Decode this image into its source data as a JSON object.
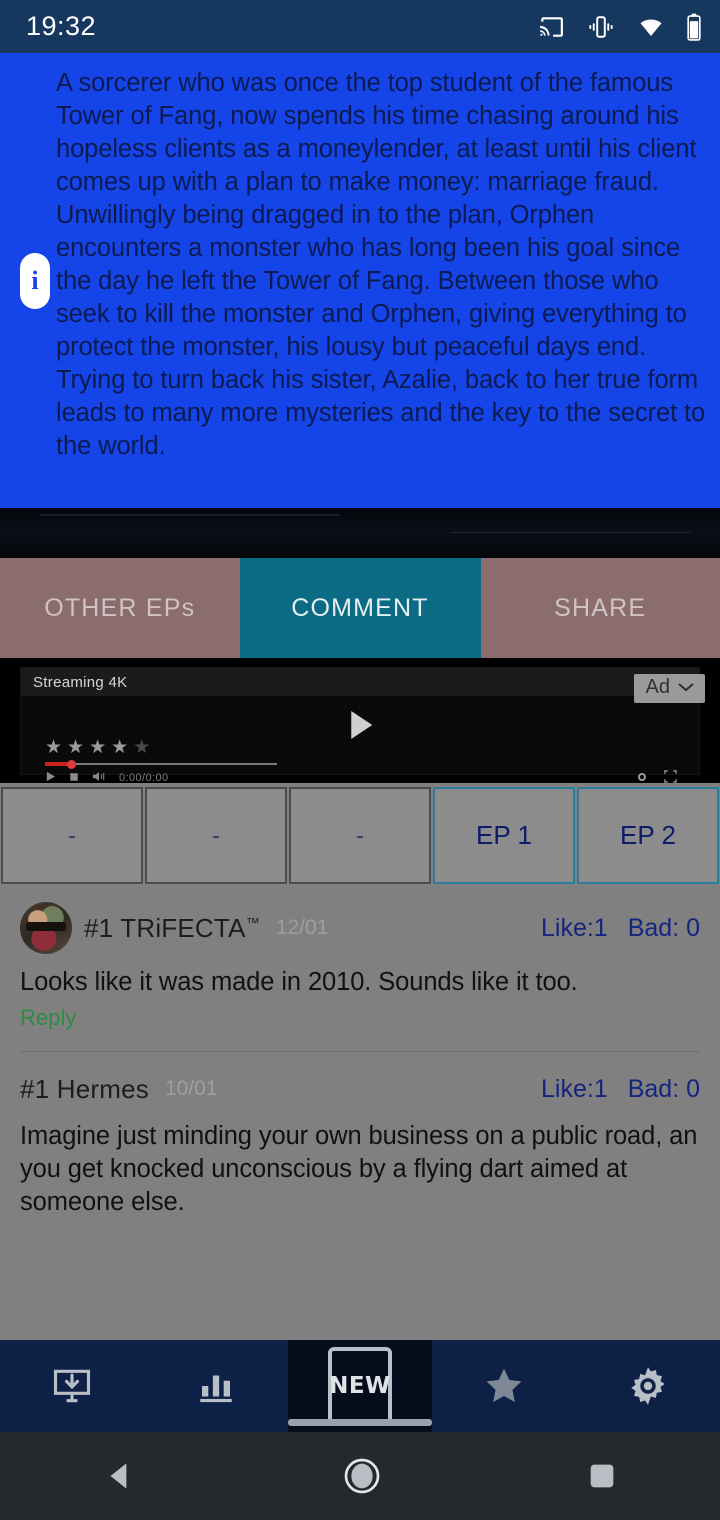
{
  "status_bar": {
    "time": "19:32",
    "icons": [
      "cast-icon",
      "vibrate-icon",
      "wifi-icon",
      "battery-icon"
    ]
  },
  "synopsis": {
    "info_icon_label": "i",
    "text": "A sorcerer who was once the top student of the famous Tower of Fang, now spends his time chasing around his hopeless clients as a moneylender, at least until his client comes up with a plan to make money: marriage fraud. Unwillingly being dragged in to the plan, Orphen encounters a monster who has long been his goal since the day he left the Tower of Fang. Between those who seek to kill the monster and Orphen, giving everything to protect the monster, his lousy but peaceful days end. Trying to turn back his sister, Azalie, back to her true form leads to many more mysteries and the key to the secret to the world."
  },
  "tabs": {
    "other_eps": "OTHER EPs",
    "comment": "COMMENT",
    "share": "SHARE",
    "active": "COMMENT",
    "active_color": "#0b6b84",
    "inactive_color": "#8a6d6c"
  },
  "ad": {
    "title": "Streaming 4K",
    "badge_label": "Ad",
    "badge_chevron": "chevron-down-icon",
    "play_icon": "play-icon",
    "stars_filled": 4,
    "stars_total": 5,
    "time": "0:00/0:00",
    "controls": [
      "play-icon",
      "stop-icon",
      "volume-icon",
      "settings-icon",
      "fullscreen-icon"
    ]
  },
  "episodes": [
    {
      "label": "-",
      "selected": false
    },
    {
      "label": "-",
      "selected": false
    },
    {
      "label": "-",
      "selected": false
    },
    {
      "label": "EP 1",
      "selected": true
    },
    {
      "label": "EP 2",
      "selected": true
    }
  ],
  "comments": [
    {
      "name": "#1 TRiFECTA",
      "name_suffix": "TM",
      "date": "12/01",
      "like": "Like:1",
      "bad": "Bad: 0",
      "body": "Looks like it was made in 2010. Sounds like it too.",
      "reply": "Reply",
      "has_avatar": true
    },
    {
      "name": "#1 Hermes",
      "name_suffix": "",
      "date": "10/01",
      "like": "Like:1",
      "bad": "Bad: 0",
      "body": "Imagine just minding your own business on a public road, an you get knocked unconscious by a flying dart aimed at someone else.",
      "reply": "",
      "has_avatar": false
    }
  ],
  "bottom_nav": {
    "items": [
      {
        "icon": "download-monitor-icon",
        "active": false
      },
      {
        "icon": "bar-chart-icon",
        "active": false
      },
      {
        "icon": "new-icon",
        "label": "NEW",
        "active": true
      },
      {
        "icon": "star-icon",
        "active": false
      },
      {
        "icon": "gear-icon",
        "active": false
      }
    ],
    "background": "#0d2046",
    "active_background": "#050c1c"
  },
  "system_nav": {
    "back": "back-icon",
    "home": "home-icon",
    "recents": "recents-icon"
  }
}
